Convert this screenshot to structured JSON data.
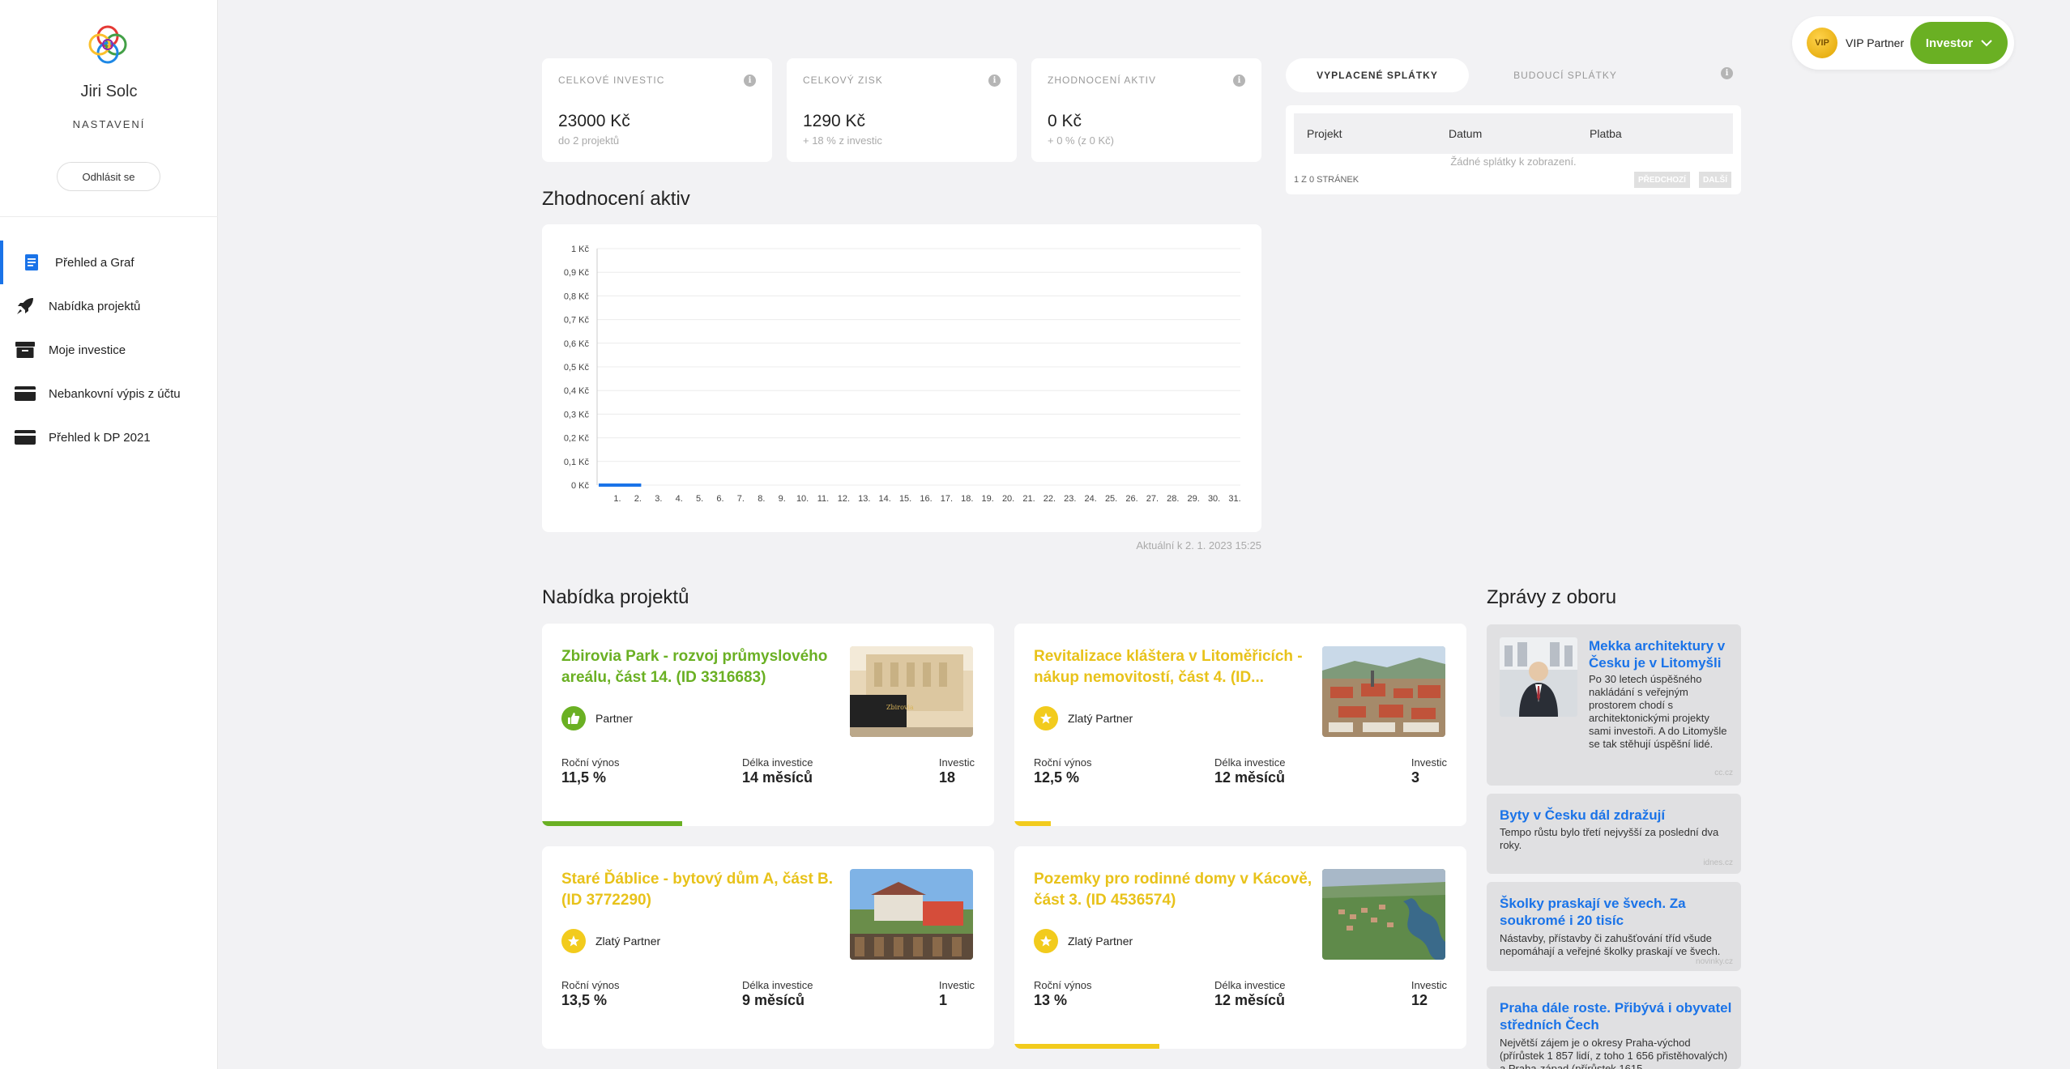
{
  "user": {
    "name": "Jiri Solc",
    "settings_label": "NASTAVENÍ",
    "logout_label": "Odhlásit se"
  },
  "nav": [
    {
      "label": "Přehled a Graf",
      "icon": "document-icon",
      "active": true
    },
    {
      "label": "Nabídka projektů",
      "icon": "rocket-icon",
      "active": false
    },
    {
      "label": "Moje investice",
      "icon": "archive-box-icon",
      "active": false
    },
    {
      "label": "Nebankovní výpis z účtu",
      "icon": "card-icon",
      "active": false
    },
    {
      "label": "Přehled k DP 2021",
      "icon": "card-icon",
      "active": false
    }
  ],
  "top": {
    "vip_badge": "VIP",
    "vip_label": "VIP Partner",
    "investor_label": "Investor"
  },
  "stats": [
    {
      "title": "CELKOVÉ INVESTIC",
      "value": "23000 Kč",
      "sub": "do 2 projektů"
    },
    {
      "title": "CELKOVÝ ZISK",
      "value": "1290 Kč",
      "sub": "+ 18 % z investic"
    },
    {
      "title": "ZHODNOCENÍ AKTIV",
      "value": "0 Kč",
      "sub": "+ 0 % (z 0 Kč)"
    }
  ],
  "info_glyph": "i",
  "payments": {
    "tab_paid": "VYPLACENÉ SPLÁTKY",
    "tab_future": "BUDOUCÍ SPLÁTKY",
    "columns": [
      "Projekt",
      "Datum",
      "Platba"
    ],
    "empty": "Žádné splátky k zobrazení.",
    "pages": "1 z 0 stránek",
    "prev": "PŘEDCHOZÍ",
    "next": "DALŠÍ"
  },
  "chart_section_title": "Zhodnocení aktiv",
  "chart_data": {
    "type": "line",
    "x": [
      "1.",
      "2.",
      "3.",
      "4.",
      "5.",
      "6.",
      "7.",
      "8.",
      "9.",
      "10.",
      "11.",
      "12.",
      "13.",
      "14.",
      "15.",
      "16.",
      "17.",
      "18.",
      "19.",
      "20.",
      "21.",
      "22.",
      "23.",
      "24.",
      "25.",
      "26.",
      "27.",
      "28.",
      "29.",
      "30.",
      "31."
    ],
    "series": [
      {
        "values": [
          0,
          0
        ]
      }
    ],
    "y_ticks": [
      "0 Kč",
      "0,1 Kč",
      "0,2 Kč",
      "0,3 Kč",
      "0,4 Kč",
      "0,5 Kč",
      "0,6 Kč",
      "0,7 Kč",
      "0,8 Kč",
      "0,9 Kč",
      "1 Kč"
    ],
    "ylim": [
      0,
      1
    ],
    "grid": true,
    "color": "#1a73e8"
  },
  "chart_updated": "Aktuální k 2. 1. 2023 15:25",
  "projects_title": "Nabídka projektů",
  "metric_labels": {
    "yield": "Roční výnos",
    "length": "Délka investice",
    "investors": "Investic"
  },
  "projects": [
    {
      "title": "Zbirovia Park - rozvoj průmyslového areálu, část 14. (ID 3316683)",
      "partner": "Partner",
      "tier": "green",
      "yield": "11,5 %",
      "length": "14 měsíců",
      "investors": "18",
      "progress": 0.31
    },
    {
      "title": "Revitalizace kláštera v Litoměřicích - nákup nemovitostí, část 4. (ID...",
      "partner": "Zlatý Partner",
      "tier": "gold",
      "yield": "12,5 %",
      "length": "12 měsíců",
      "investors": "3",
      "progress": 0.08
    },
    {
      "title": "Staré Ďáblice - bytový dům A, část B. (ID 3772290)",
      "partner": "Zlatý Partner",
      "tier": "gold",
      "yield": "13,5 %",
      "length": "9 měsíců",
      "investors": "1",
      "progress": 0
    },
    {
      "title": "Pozemky pro rodinné domy v Kácově, část 3. (ID 4536574)",
      "partner": "Zlatý Partner",
      "tier": "gold",
      "yield": "13 %",
      "length": "12 měsíců",
      "investors": "12",
      "progress": 0.32
    }
  ],
  "news_title": "Zprávy z oboru",
  "news": [
    {
      "title": "Mekka architektury v Česku je v Litomyšli",
      "body": "Po 30 letech úspěšného nakládání s veřejným prostorem chodí s architektonickými projekty sami investoři. A do Litomyšle se tak stěhují úspěšní lidé.",
      "source": "cc.cz"
    },
    {
      "title": "Byty v Česku dál zdražují",
      "body": "Tempo růstu bylo třetí nejvyšší za poslední dva roky.",
      "source": "idnes.cz"
    },
    {
      "title": "Školky praskají ve švech. Za soukromé i 20 tisíc",
      "body": "Nástavby, přístavby či zahušťování tříd všude nepomáhají a veřejné školky praskají ve švech.",
      "source": "novinky.cz"
    },
    {
      "title": "Praha dále roste. Přibývá i obyvatel středních Čech",
      "body": "Největší zájem je o okresy Praha-východ (přírůstek 1 857 lidí, z toho 1 656 přistěhovalých) a Praha-západ (přírůstek 1615",
      "source": ""
    }
  ]
}
